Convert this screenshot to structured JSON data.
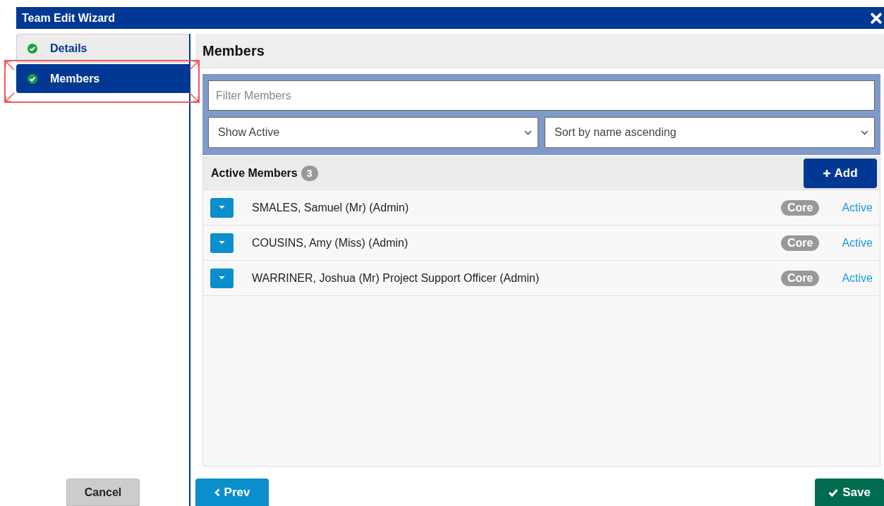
{
  "window": {
    "title": "Team Edit Wizard"
  },
  "steps": [
    {
      "label": "Details",
      "selected": false,
      "highlighted": false
    },
    {
      "label": "Members",
      "selected": true,
      "highlighted": true
    }
  ],
  "panel": {
    "title": "Members",
    "filter": {
      "placeholder": "Filter Members"
    },
    "show_select": {
      "value": "Show Active"
    },
    "sort_select": {
      "value": "Sort by name ascending"
    }
  },
  "list": {
    "title": "Active Members",
    "count": "3",
    "add_button": "Add",
    "rows": [
      {
        "name": "SMALES, Samuel (Mr) (Admin)",
        "tag": "Core",
        "status": "Active"
      },
      {
        "name": "COUSINS, Amy (Miss) (Admin)",
        "tag": "Core",
        "status": "Active"
      },
      {
        "name": "WARRINER, Joshua (Mr) Project Support Officer (Admin)",
        "tag": "Core",
        "status": "Active"
      }
    ]
  },
  "buttons": {
    "cancel": "Cancel",
    "prev": "Prev",
    "save": "Save"
  }
}
